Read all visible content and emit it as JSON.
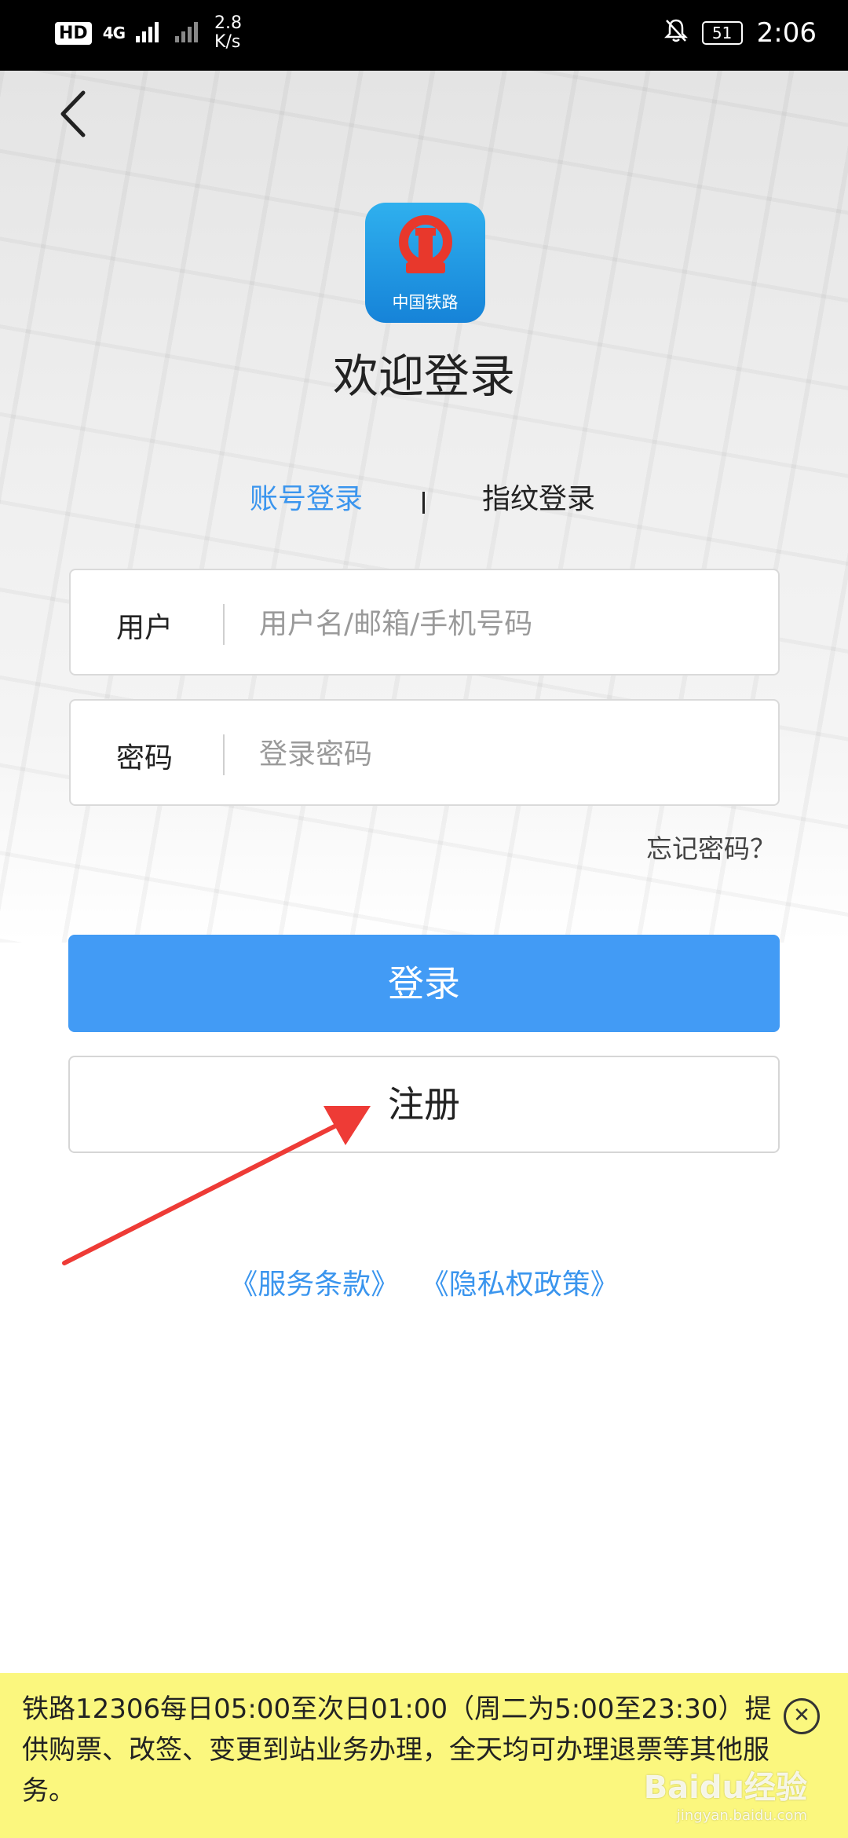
{
  "status_bar": {
    "hd": "HD",
    "network": "4G",
    "speed_value": "2.8",
    "speed_unit": "K/s",
    "battery": "51",
    "time": "2:06"
  },
  "logo": {
    "text": "中国铁路",
    "color": "#1E90E6"
  },
  "title": "欢迎登录",
  "tabs": {
    "account": "账号登录",
    "fingerprint": "指纹登录",
    "active_color": "#3A95EE"
  },
  "form": {
    "user_label": "用户",
    "user_placeholder": "用户名/邮箱/手机号码",
    "user_value": "",
    "password_label": "密码",
    "password_placeholder": "登录密码",
    "password_value": "",
    "forgot": "忘记密码？"
  },
  "buttons": {
    "login": "登录",
    "register": "注册",
    "login_color": "#429BF5"
  },
  "links": {
    "terms": "《服务条款》",
    "privacy": "《隐私权政策》"
  },
  "notice": {
    "text": "铁路12306每日05:00至次日01:00（周二为5:00至23:30）提供购票、改签、变更到站业务办理，全天均可办理退票等其他服务。",
    "background": "#FBF77E"
  },
  "watermark": {
    "brand": "Baidu经验",
    "url": "jingyan.baidu.com"
  }
}
